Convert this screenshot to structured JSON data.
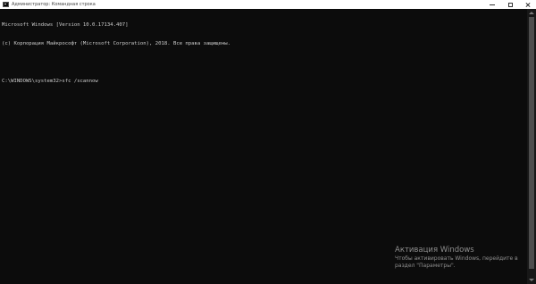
{
  "window": {
    "title": "Администратор: Командная строка",
    "icon": "cmd-icon"
  },
  "console": {
    "lines": [
      "Microsoft Windows [Version 10.0.17134.407]",
      "(c) Корпорация Майкрософт (Microsoft Corporation), 2018. Все права защищены.",
      "",
      "C:\\WINDOWS\\system32>sfc /scannow"
    ]
  },
  "activation": {
    "title": "Активация Windows",
    "description": "Чтобы активировать Windows, перейдите в раздел \"Параметры\"."
  },
  "colors": {
    "console_background": "#0c0c0c",
    "console_text": "#cccccc",
    "titlebar": "#ffffff"
  }
}
